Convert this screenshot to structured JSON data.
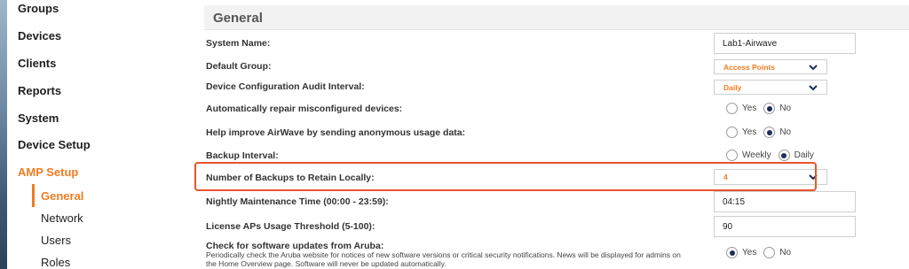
{
  "sidebar": {
    "items": [
      {
        "label": "Groups"
      },
      {
        "label": "Devices"
      },
      {
        "label": "Clients"
      },
      {
        "label": "Reports"
      },
      {
        "label": "System"
      },
      {
        "label": "Device Setup"
      },
      {
        "label": "AMP Setup"
      }
    ],
    "subitems": [
      {
        "label": "General"
      },
      {
        "label": "Network"
      },
      {
        "label": "Users"
      },
      {
        "label": "Roles"
      }
    ]
  },
  "section": {
    "title": "General"
  },
  "settings": {
    "system_name": {
      "label": "System Name:",
      "value": "Lab1-Airwave"
    },
    "default_group": {
      "label": "Default Group:",
      "value": "Access Points"
    },
    "audit_interval": {
      "label": "Device Configuration Audit Interval:",
      "value": "Daily"
    },
    "auto_repair": {
      "label": "Automatically repair misconfigured devices:",
      "yes": "Yes",
      "no": "No",
      "selected": "No"
    },
    "usage_data": {
      "label": "Help improve AirWave by sending anonymous usage data:",
      "yes": "Yes",
      "no": "No",
      "selected": "No"
    },
    "backup_interval": {
      "label": "Backup Interval:",
      "weekly": "Weekly",
      "daily": "Daily",
      "selected": "Daily"
    },
    "backups_retain": {
      "label": "Number of Backups to Retain Locally:",
      "value": "4"
    },
    "maintenance_time": {
      "label": "Nightly Maintenance Time (00:00 - 23:59):",
      "value": "04:15"
    },
    "license_threshold": {
      "label": "License APs Usage Threshold (5-100):",
      "value": "90"
    },
    "software_updates": {
      "label": "Check for software updates from Aruba:",
      "description": "Periodically check the Aruba website for notices of new software versions or critical security notifications. News will be displayed for admins on the Home Overview page. Software will never be updated automatically.",
      "yes": "Yes",
      "no": "No",
      "selected": "Yes"
    }
  },
  "colors": {
    "accent": "#f07c22",
    "highlight": "#e8542f",
    "radio_fill": "#1e2d5a"
  },
  "icons": {
    "select": "chevron-down-icon"
  }
}
